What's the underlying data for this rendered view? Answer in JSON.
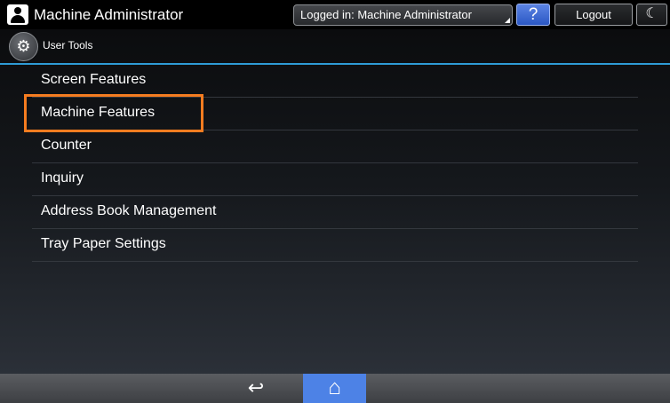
{
  "header": {
    "title": "Machine Administrator",
    "login_status": "Logged in: Machine Administrator",
    "help_label": "?",
    "logout_label": "Logout",
    "sleep_icon": "☾",
    "user_icon": "user-icon"
  },
  "section": {
    "title": "User Tools",
    "icon": "gear-icon",
    "icon_glyph": "⚙"
  },
  "menu": {
    "items": [
      {
        "label": "Screen Features",
        "selected": false
      },
      {
        "label": "Machine Features",
        "selected": true
      },
      {
        "label": "Counter",
        "selected": false
      },
      {
        "label": "Inquiry",
        "selected": false
      },
      {
        "label": "Address Book Management",
        "selected": false
      },
      {
        "label": "Tray Paper Settings",
        "selected": false
      }
    ]
  },
  "footer": {
    "back_glyph": "↩",
    "home_glyph": "⌂"
  },
  "colors": {
    "accent_line": "#2e9bd6",
    "selection_outline": "#f47c20",
    "home_button": "#4d82e6",
    "help_button": "#2b57c4"
  }
}
